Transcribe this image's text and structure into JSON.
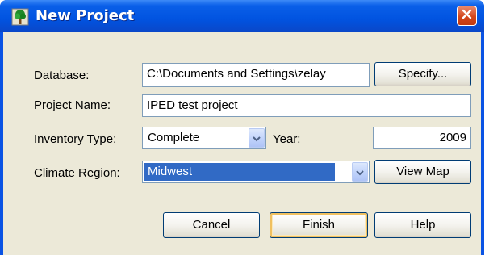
{
  "window": {
    "title": "New Project",
    "title_icon": "tree-app-icon",
    "close_icon": "close-icon"
  },
  "form": {
    "database": {
      "label": "Database:",
      "value": "C:\\Documents and Settings\\zelay",
      "button_label": "Specify..."
    },
    "project_name": {
      "label": "Project Name:",
      "value": "IPED test project"
    },
    "inventory_type": {
      "label": "Inventory Type:",
      "selected": "Complete"
    },
    "year": {
      "label": "Year:",
      "value": "2009"
    },
    "climate_region": {
      "label": "Climate Region:",
      "selected": "Midwest",
      "button_label": "View Map"
    }
  },
  "buttons": {
    "cancel": "Cancel",
    "finish": "Finish",
    "help": "Help"
  },
  "colors": {
    "titlebar": "#0153e0",
    "client_background": "#ece9d8",
    "selection": "#316ac5",
    "close_button": "#d3461c"
  }
}
